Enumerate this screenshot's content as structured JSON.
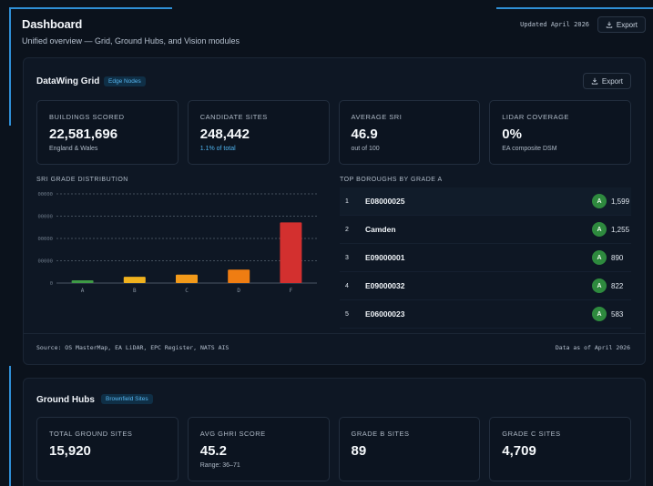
{
  "header": {
    "title": "Dashboard",
    "subtitle": "Unified overview — Grid, Ground Hubs, and Vision modules",
    "updated": "Updated April 2026",
    "export_label": "Export"
  },
  "datawing": {
    "title": "DataWing Grid",
    "tag": "Edge Nodes",
    "export_label": "Export",
    "stats": [
      {
        "label": "BUILDINGS SCORED",
        "value": "22,581,696",
        "sub": "England & Wales"
      },
      {
        "label": "CANDIDATE SITES",
        "value": "248,442",
        "sub": "1.1% of total"
      },
      {
        "label": "AVERAGE SRI",
        "value": "46.9",
        "sub": "out of 100"
      },
      {
        "label": "LIDAR COVERAGE",
        "value": "0%",
        "sub": "EA composite DSM"
      }
    ],
    "chart_label": "SRI GRADE DISTRIBUTION",
    "boroughs_label": "TOP BOROUGHS BY GRADE A",
    "boroughs": [
      {
        "rank": "1",
        "name": "E08000025",
        "grade": "A",
        "count": "1,599"
      },
      {
        "rank": "2",
        "name": "Camden",
        "grade": "A",
        "count": "1,255"
      },
      {
        "rank": "3",
        "name": "E09000001",
        "grade": "A",
        "count": "890"
      },
      {
        "rank": "4",
        "name": "E09000032",
        "grade": "A",
        "count": "822"
      },
      {
        "rank": "5",
        "name": "E06000023",
        "grade": "A",
        "count": "583"
      }
    ],
    "source": "Source: OS MasterMap, EA LiDAR, EPC Register, NATS AIS",
    "as_of": "Data as of April 2026"
  },
  "chart_data": {
    "type": "bar",
    "categories": [
      "A",
      "B",
      "C",
      "D",
      "F"
    ],
    "values": [
      120000,
      280000,
      380000,
      600000,
      2720000
    ],
    "ylim": [
      0,
      4000000
    ],
    "y_ticks": [
      0,
      1000000,
      2000000,
      3000000,
      4000000
    ],
    "y_tick_labels": [
      "0",
      "00000",
      "00000",
      "00000",
      "00000"
    ],
    "colors": [
      "#3e9a45",
      "#f0b21e",
      "#f29a1a",
      "#ef7d12",
      "#d3302f"
    ],
    "grid": true,
    "title": "",
    "xlabel": "",
    "ylabel": ""
  },
  "ground_hubs": {
    "title": "Ground Hubs",
    "tag": "Brownfield Sites",
    "stats": [
      {
        "label": "TOTAL GROUND SITES",
        "value": "15,920",
        "sub": ""
      },
      {
        "label": "AVG GHRI SCORE",
        "value": "45.2",
        "sub": "Range: 36–71"
      },
      {
        "label": "GRADE B SITES",
        "value": "89",
        "sub": ""
      },
      {
        "label": "GRADE C SITES",
        "value": "4,709",
        "sub": ""
      }
    ]
  },
  "colors": {
    "background": "#0b121c",
    "accent": "#2f8fd6",
    "tag_text": "#56b6f0",
    "grade_a": "#2e8a3e"
  }
}
